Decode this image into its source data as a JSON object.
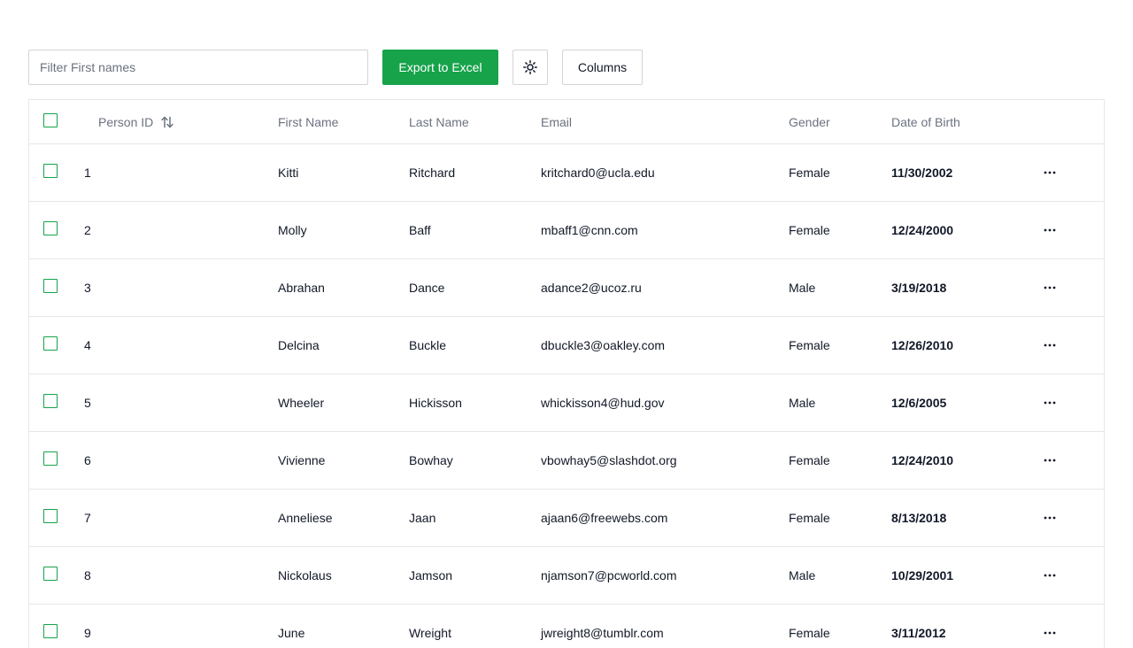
{
  "toolbar": {
    "filter_placeholder": "Filter First names",
    "filter_value": "",
    "export_label": "Export to Excel",
    "theme_icon": "sun-icon",
    "columns_label": "Columns"
  },
  "table": {
    "headers": {
      "id": "Person ID",
      "first": "First Name",
      "last": "Last Name",
      "email": "Email",
      "gender": "Gender",
      "dob": "Date of Birth"
    },
    "sort_icon": "sort-arrows-icon",
    "row_menu_icon": "more-horizontal-icon",
    "accent_color": "#16a34a",
    "rows": [
      {
        "id": "1",
        "first": "Kitti",
        "last": "Ritchard",
        "email": "kritchard0@ucla.edu",
        "gender": "Female",
        "dob": "11/30/2002"
      },
      {
        "id": "2",
        "first": "Molly",
        "last": "Baff",
        "email": "mbaff1@cnn.com",
        "gender": "Female",
        "dob": "12/24/2000"
      },
      {
        "id": "3",
        "first": "Abrahan",
        "last": "Dance",
        "email": "adance2@ucoz.ru",
        "gender": "Male",
        "dob": "3/19/2018"
      },
      {
        "id": "4",
        "first": "Delcina",
        "last": "Buckle",
        "email": "dbuckle3@oakley.com",
        "gender": "Female",
        "dob": "12/26/2010"
      },
      {
        "id": "5",
        "first": "Wheeler",
        "last": "Hickisson",
        "email": "whickisson4@hud.gov",
        "gender": "Male",
        "dob": "12/6/2005"
      },
      {
        "id": "6",
        "first": "Vivienne",
        "last": "Bowhay",
        "email": "vbowhay5@slashdot.org",
        "gender": "Female",
        "dob": "12/24/2010"
      },
      {
        "id": "7",
        "first": "Anneliese",
        "last": "Jaan",
        "email": "ajaan6@freewebs.com",
        "gender": "Female",
        "dob": "8/13/2018"
      },
      {
        "id": "8",
        "first": "Nickolaus",
        "last": "Jamson",
        "email": "njamson7@pcworld.com",
        "gender": "Male",
        "dob": "10/29/2001"
      },
      {
        "id": "9",
        "first": "June",
        "last": "Wreight",
        "email": "jwreight8@tumblr.com",
        "gender": "Female",
        "dob": "3/11/2012"
      }
    ]
  }
}
